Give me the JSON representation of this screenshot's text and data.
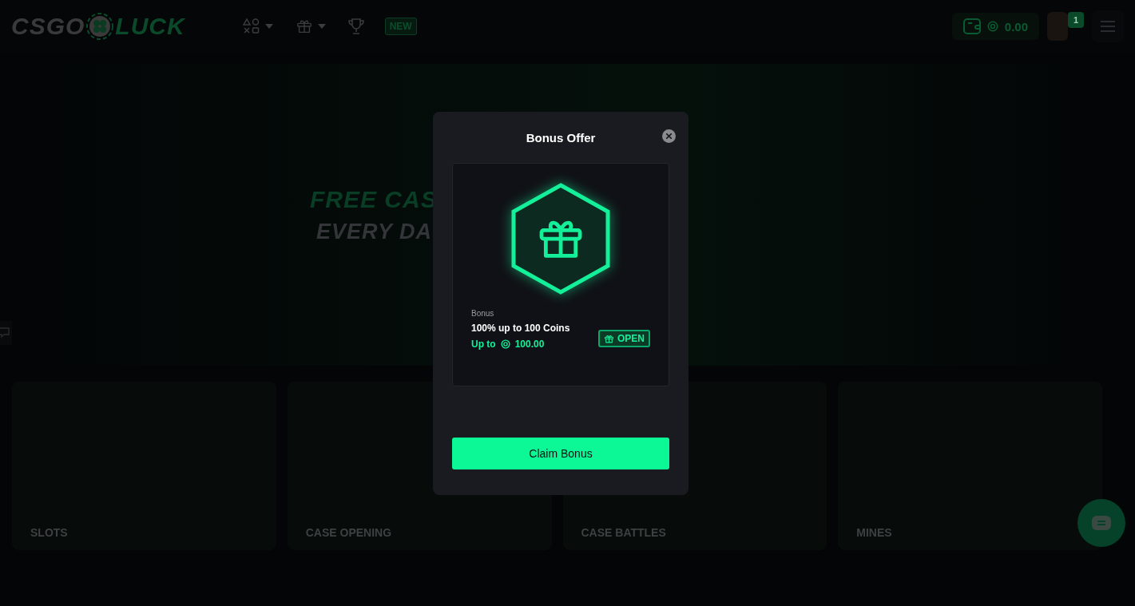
{
  "header": {
    "logo": {
      "left": "CSGO",
      "right": "LUCK"
    },
    "nav_badge": "NEW",
    "balance": "0.00",
    "notification_count": "1"
  },
  "banner": {
    "title": "FREE CAS",
    "subtitle": "EVERY DA"
  },
  "tiles": [
    {
      "label": "SLOTS"
    },
    {
      "label": "CASE OPENING"
    },
    {
      "label": "CASE BATTLES"
    },
    {
      "label": "MINES"
    }
  ],
  "modal": {
    "title": "Bonus Offer",
    "card": {
      "caption": "Bonus",
      "name": "100% up to 100 Coins",
      "amount_label": "Up to",
      "amount": "100.00",
      "open_button": "OPEN"
    },
    "claim_button": "Claim Bonus"
  }
}
